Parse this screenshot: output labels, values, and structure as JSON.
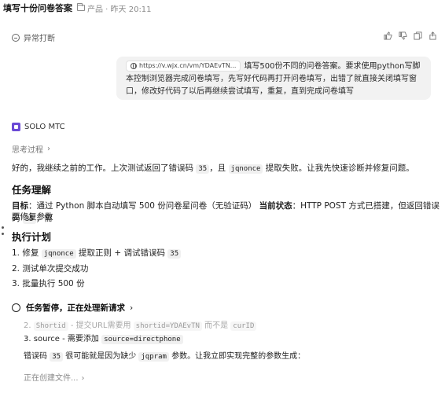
{
  "topbar": {
    "title": "填写十份问卷答案",
    "meta": "产品 · 昨天 20:11"
  },
  "interrupt": {
    "label": "异常打断"
  },
  "user_message": {
    "url": "https://v.wjx.cn/vm/YDAEvTN...",
    "text": "填写500份不同的问卷答案。要求使用python写脚本控制浏览器完成问卷填写，先写好代码再打开问卷填写，出错了就直接关闭填写窗口，修改好代码了以后再继续尝试填写，重复，直到完成问卷填写"
  },
  "agent": {
    "name": "SOLO MTC"
  },
  "thinking": {
    "label": "思考过程"
  },
  "intro": {
    "before_code1": "好的，我继续之前的工作。上次测试返回了错误码 ",
    "code1": "35",
    "between": "，且 ",
    "code2": "jqnonce",
    "after": " 提取失败。让我先快速诊断并修复问题。"
  },
  "section_understanding": {
    "heading": "任务理解",
    "goal_label": "目标",
    "goal_text": "：通过 Python 脚本自动填写 500 份问卷星问卷（无验证码） ",
    "state_label": "当前状态",
    "state_text": "：HTTP POST 方式已搭建，但返回错误码 ",
    "state_code": "35",
    "state_text2": "，需",
    "state_line2": "要修复参数"
  },
  "section_plan": {
    "heading": "执行计划",
    "steps": [
      {
        "num": "1. ",
        "pre": "修复 ",
        "code": "jqnonce",
        "mid": " 提取正则 + 调试错误码 ",
        "code2": "35"
      },
      {
        "num": "2. ",
        "text": "测试单次提交成功"
      },
      {
        "num": "3. ",
        "text": "批量执行 500 份"
      }
    ]
  },
  "status": {
    "label": "任务暂停，正在处理新请求"
  },
  "faded_line": {
    "num": "2. ",
    "code": "Shortid",
    "text": " - 提交URL需要用 ",
    "code2": "shortid=YDAEvTN",
    "text2": " 而不是 ",
    "code3": "curID"
  },
  "source_line": {
    "num": "3. ",
    "label": "source",
    "text": " - 需要添加 ",
    "code": "source=directphone"
  },
  "error_line": {
    "pre": "错误码 ",
    "code": "35",
    "mid": " 很可能就是因为缺少 ",
    "code2": "jqpram",
    "post": " 参数。让我立即实现完整的参数生成："
  },
  "creating": {
    "label": "正在创建文件..."
  }
}
